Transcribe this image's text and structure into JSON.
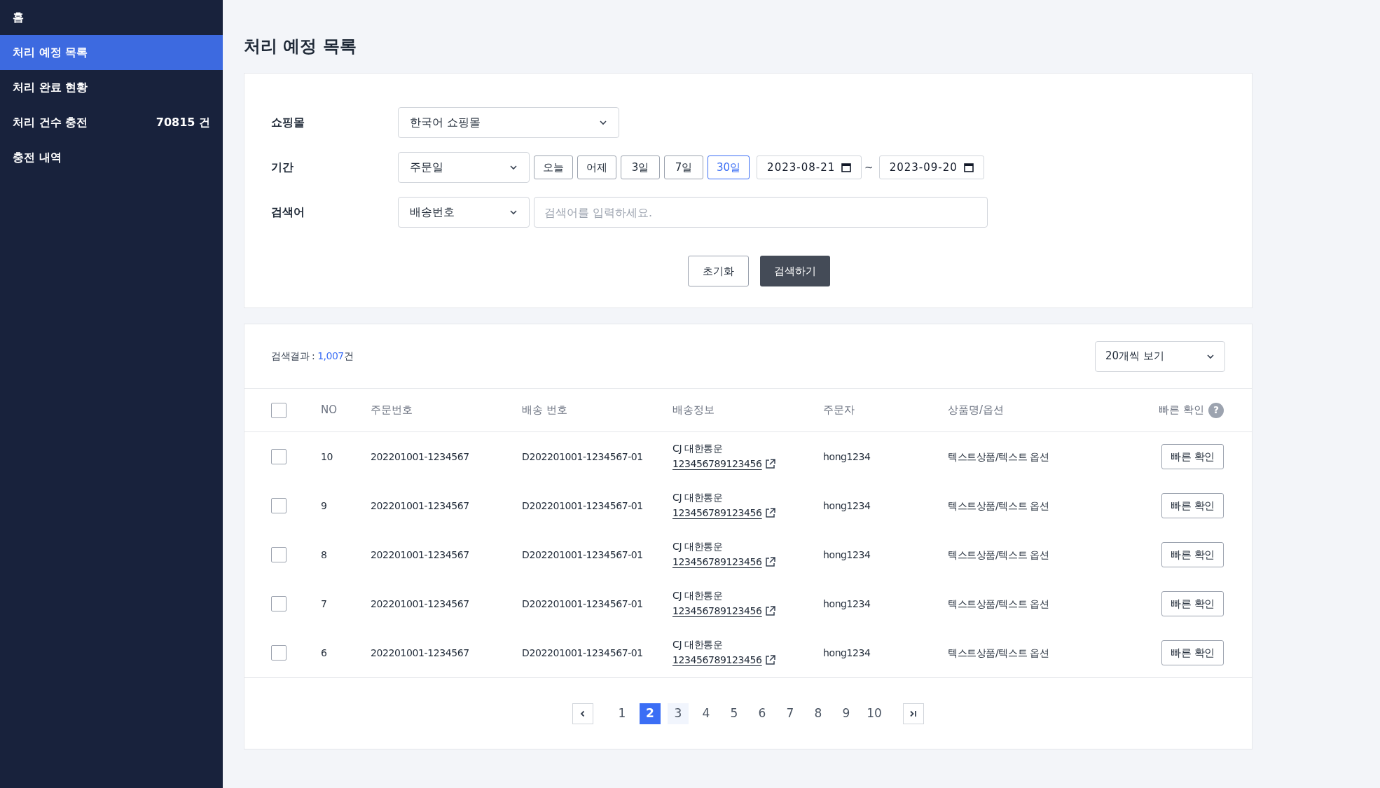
{
  "sidebar": {
    "items": [
      {
        "label": "홈",
        "selected": false
      },
      {
        "label": "처리 예정 목록",
        "selected": true
      },
      {
        "label": "처리 완료 현황",
        "selected": false
      },
      {
        "label": "처리 건수 충전",
        "selected": false,
        "count": "70815 건"
      },
      {
        "label": "충전 내역",
        "selected": false
      }
    ]
  },
  "page_title": "처리 예정 목록",
  "filters": {
    "shop": {
      "label": "쇼핑몰",
      "value": "한국어 쇼핑몰"
    },
    "period": {
      "label": "기간",
      "type_value": "주문일",
      "quick": [
        {
          "label": "오늘",
          "selected": false
        },
        {
          "label": "어제",
          "selected": false
        },
        {
          "label": "3일",
          "selected": false
        },
        {
          "label": "7일",
          "selected": false
        },
        {
          "label": "30일",
          "selected": true
        }
      ],
      "date_from": "2023-08-21",
      "separator": "~",
      "date_to": "2023-09-20"
    },
    "keyword": {
      "label": "검색어",
      "type_value": "배송번호",
      "placeholder": "검색어를 입력하세요."
    },
    "reset_button": "초기화",
    "search_button": "검색하기"
  },
  "results": {
    "summary_label": "검색결과 :",
    "count": "1,007",
    "count_unit": "건",
    "per_page": "20개씩 보기",
    "header_checked": false,
    "columns": [
      "NO",
      "주문번호",
      "배송 번호",
      "배송정보",
      "주문자",
      "상품명/옵션",
      "빠른 확인"
    ],
    "help_mark": "?",
    "rows": [
      {
        "checked": false,
        "no": "10",
        "order_no": "202201001-1234567",
        "shipping_no": "D202201001-1234567-01",
        "carrier": "CJ 대한통운",
        "tracking": "123456789123456",
        "customer": "hong1234",
        "product": "텍스트상품/텍스트 옵션",
        "action": "빠른 확인"
      },
      {
        "checked": false,
        "no": "9",
        "order_no": "202201001-1234567",
        "shipping_no": "D202201001-1234567-01",
        "carrier": "CJ 대한통운",
        "tracking": "123456789123456",
        "customer": "hong1234",
        "product": "텍스트상품/텍스트 옵션",
        "action": "빠른 확인"
      },
      {
        "checked": false,
        "no": "8",
        "order_no": "202201001-1234567",
        "shipping_no": "D202201001-1234567-01",
        "carrier": "CJ 대한통운",
        "tracking": "123456789123456",
        "customer": "hong1234",
        "product": "텍스트상품/텍스트 옵션",
        "action": "빠른 확인"
      },
      {
        "checked": false,
        "no": "7",
        "order_no": "202201001-1234567",
        "shipping_no": "D202201001-1234567-01",
        "carrier": "CJ 대한통운",
        "tracking": "123456789123456",
        "customer": "hong1234",
        "product": "텍스트상품/텍스트 옵션",
        "action": "빠른 확인"
      },
      {
        "checked": false,
        "no": "6",
        "order_no": "202201001-1234567",
        "shipping_no": "D202201001-1234567-01",
        "carrier": "CJ 대한통운",
        "tracking": "123456789123456",
        "customer": "hong1234",
        "product": "텍스트상품/텍스트 옵션",
        "action": "빠른 확인"
      }
    ],
    "pagination": {
      "pages": [
        {
          "label": "1",
          "selected": false,
          "hovered": false
        },
        {
          "label": "2",
          "selected": true,
          "hovered": false
        },
        {
          "label": "3",
          "selected": false,
          "hovered": true
        },
        {
          "label": "4",
          "selected": false,
          "hovered": false
        },
        {
          "label": "5",
          "selected": false,
          "hovered": false
        },
        {
          "label": "6",
          "selected": false,
          "hovered": false
        },
        {
          "label": "7",
          "selected": false,
          "hovered": false
        },
        {
          "label": "8",
          "selected": false,
          "hovered": false
        },
        {
          "label": "9",
          "selected": false,
          "hovered": false
        },
        {
          "label": "10",
          "selected": false,
          "hovered": false
        }
      ]
    }
  }
}
